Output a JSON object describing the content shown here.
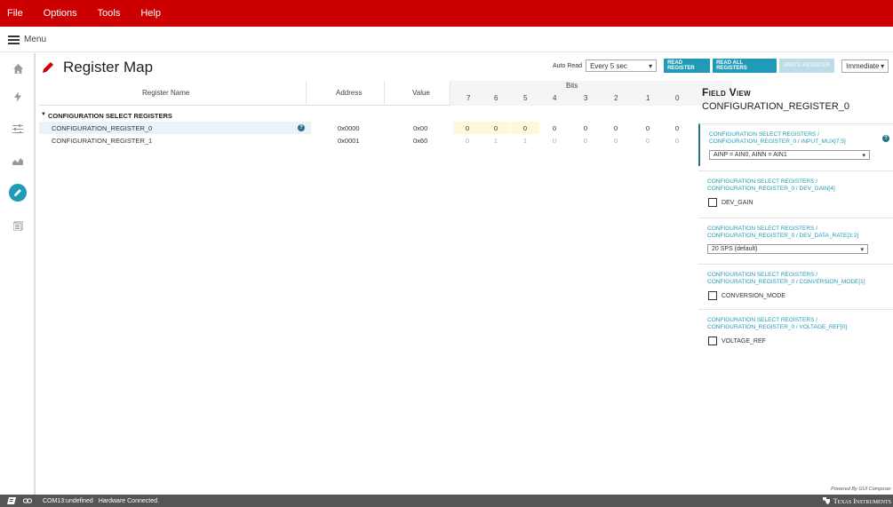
{
  "menubar": {
    "items": [
      "File",
      "Options",
      "Tools",
      "Help"
    ]
  },
  "subbar": {
    "menu_label": "Menu"
  },
  "leftnav": {
    "icons": [
      "home-icon",
      "flash-icon",
      "sliders-icon",
      "chart-icon",
      "pencil-icon",
      "document-icon"
    ],
    "active": "pencil-icon"
  },
  "header": {
    "title": "Register Map"
  },
  "toolbar": {
    "auto_read_label": "Auto Read",
    "auto_read_value": "Every 5 sec",
    "read_register": "READ REGISTER",
    "read_all_registers": "READ ALL REGISTERS",
    "write_register": "WRITE REGISTER",
    "mode_value": "Immediate"
  },
  "table": {
    "headers": {
      "name": "Register Name",
      "address": "Address",
      "value": "Value",
      "bits": "Bits",
      "bit_numbers": [
        "7",
        "6",
        "5",
        "4",
        "3",
        "2",
        "1",
        "0"
      ]
    },
    "group": "CONFIGURATION SELECT REGISTERS",
    "rows": [
      {
        "name": "CONFIGURATION_REGISTER_0",
        "address": "0x0000",
        "value": "0x00",
        "bits": [
          "0",
          "0",
          "0",
          "0",
          "0",
          "0",
          "0",
          "0"
        ]
      },
      {
        "name": "CONFIGURATION_REGISTER_1",
        "address": "0x0001",
        "value": "0x60",
        "bits": [
          "0",
          "1",
          "1",
          "0",
          "0",
          "0",
          "0",
          "0"
        ]
      }
    ]
  },
  "field_view": {
    "title": "Field View",
    "register": "CONFIGURATION_REGISTER_0",
    "fields": [
      {
        "label": "CONFIGURATION SELECT REGISTERS / CONFIGURATION_REGISTER_0 / INPUT_MUX[7:5]",
        "kind": "select",
        "value": "AINP = AIN0, AINN = AIN1"
      },
      {
        "label": "CONFIGURATION SELECT REGISTERS / CONFIGURATION_REGISTER_0 / DEV_GAIN[4]",
        "kind": "checkbox",
        "value": "DEV_GAIN"
      },
      {
        "label": "CONFIGURATION SELECT REGISTERS / CONFIGURATION_REGISTER_0 / DEV_DATA_RATE[3:2]",
        "kind": "select",
        "value": "20 SPS (default)"
      },
      {
        "label": "CONFIGURATION SELECT REGISTERS / CONFIGURATION_REGISTER_0 / CONVERSION_MODE[1]",
        "kind": "checkbox",
        "value": "CONVERSION_MODE"
      },
      {
        "label": "CONFIGURATION SELECT REGISTERS / CONFIGURATION_REGISTER_0 / VOLTAGE_REF[0]",
        "kind": "checkbox",
        "value": "VOLTAGE_REF"
      }
    ]
  },
  "footer": {
    "powered_by": "Powered By GUI Composer",
    "status_port": "COM13:undefined",
    "status_connection": "Hardware Connected.",
    "brand": "Texas Instruments"
  },
  "colors": {
    "menubar": "#cc0000",
    "accent": "#1f9bb8",
    "statusbar": "#555555"
  }
}
